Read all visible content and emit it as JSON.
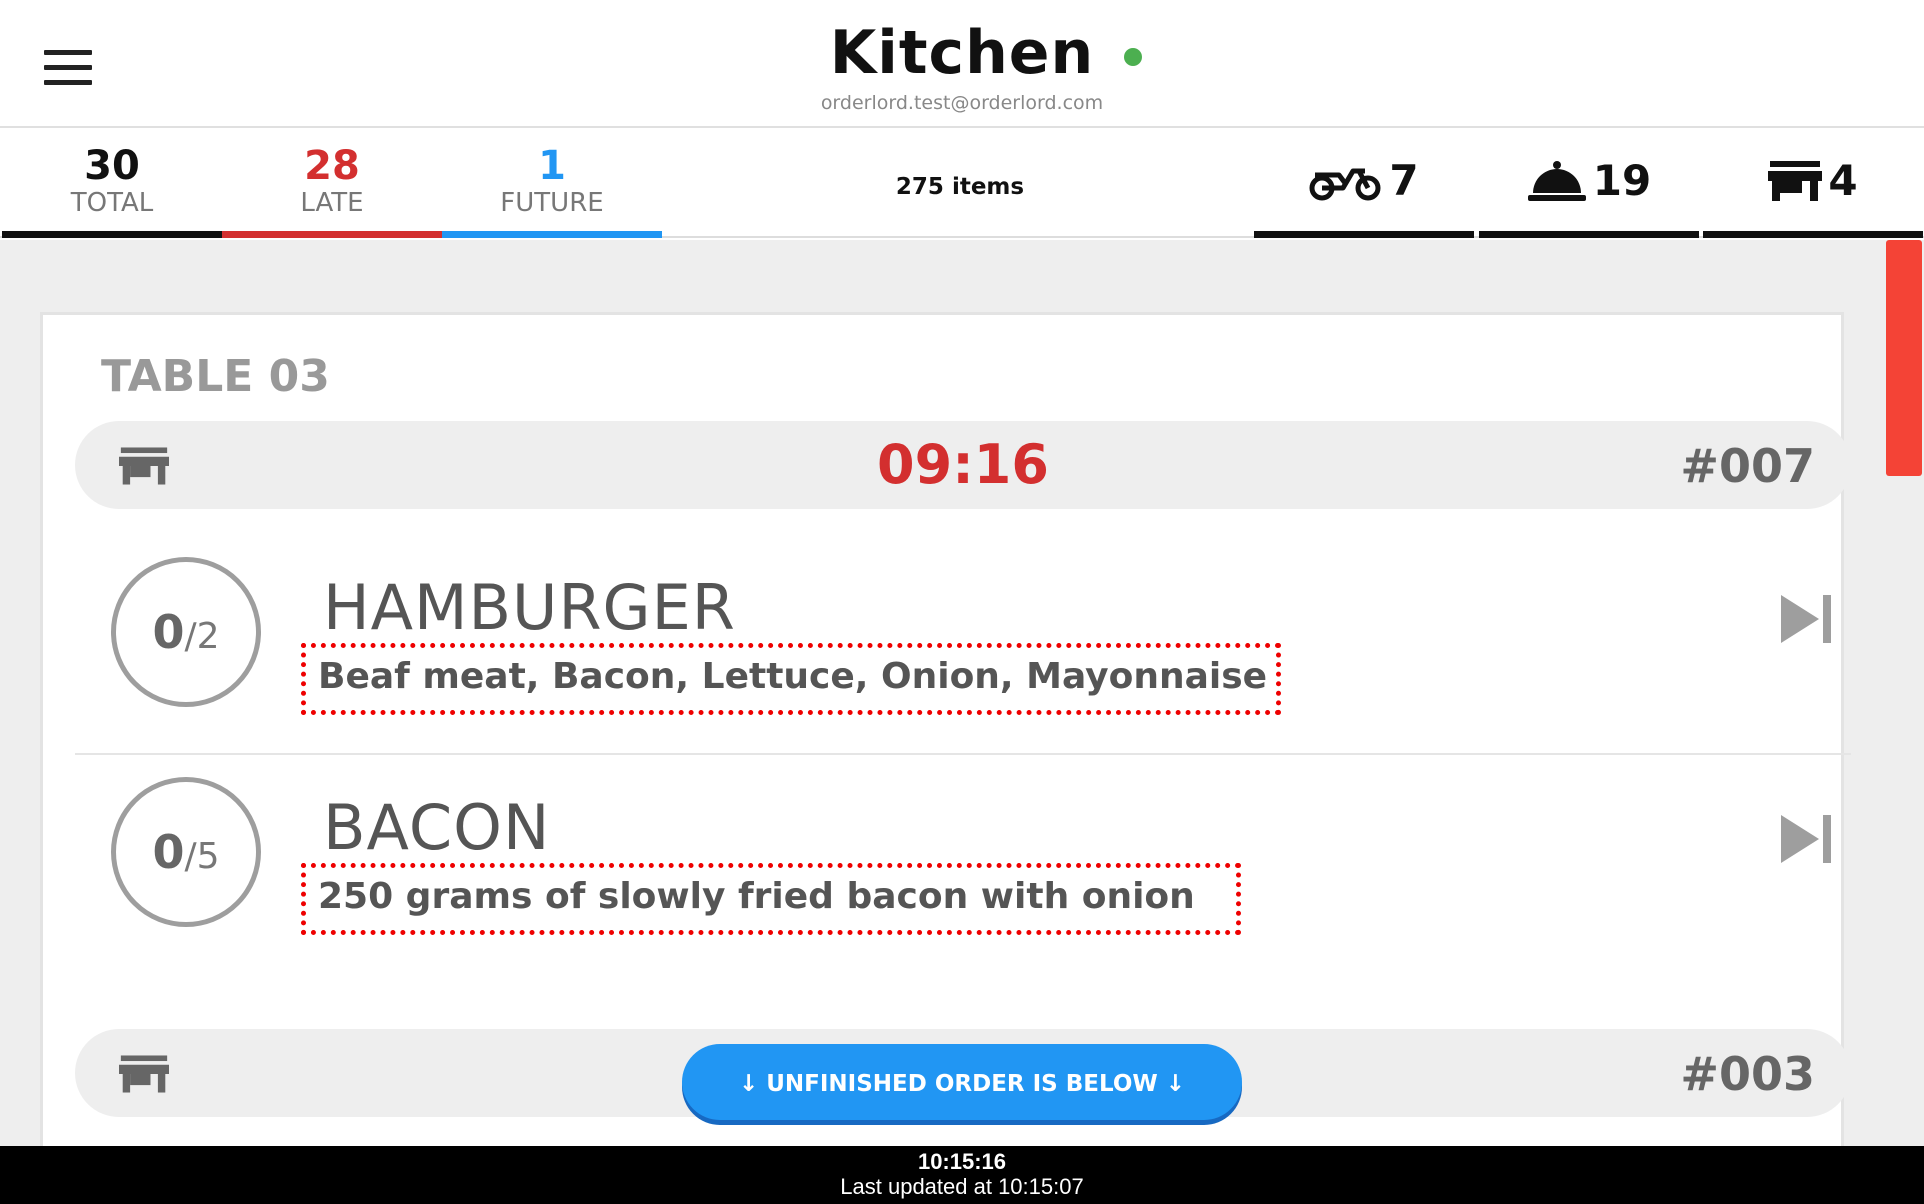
{
  "header": {
    "title": "Kitchen",
    "account": "orderlord.test@orderlord.com",
    "status_color": "#4caf50",
    "menu_icon": "hamburger-menu-icon"
  },
  "stats": {
    "total": {
      "value": "30",
      "label": "TOTAL",
      "color": "#111111"
    },
    "late": {
      "value": "28",
      "label": "LATE",
      "color": "#d32f2f"
    },
    "future": {
      "value": "1",
      "label": "FUTURE",
      "color": "#2196f3"
    },
    "items": "275 items"
  },
  "modes": {
    "delivery": {
      "icon": "scooter-icon",
      "count": "7"
    },
    "dine_in": {
      "icon": "cloche-icon",
      "count": "19"
    },
    "takeaway": {
      "icon": "store-icon",
      "count": "4"
    }
  },
  "card": {
    "table": "TABLE 03",
    "orders": [
      {
        "icon": "store-icon",
        "time": "09:16",
        "number": "#007"
      },
      {
        "icon": "store-icon",
        "number": "#003"
      }
    ],
    "items": [
      {
        "done": "0",
        "total": "/2",
        "name": "HAMBURGER",
        "description": "Beaf meat, Bacon, Lettuce, Onion, Mayonnaise"
      },
      {
        "done": "0",
        "total": "/5",
        "name": "BACON",
        "description": "250 grams of slowly fried bacon with onion"
      }
    ]
  },
  "unfinished_button": "↓ UNFINISHED ORDER IS BELOW ↓",
  "footer": {
    "clock": "10:15:16",
    "last_updated": "Last updated at 10:15:07"
  },
  "colors": {
    "late": "#d32f2f",
    "future": "#2196f3",
    "scrollbar": "#f44336",
    "highlight": "#ee0000"
  }
}
